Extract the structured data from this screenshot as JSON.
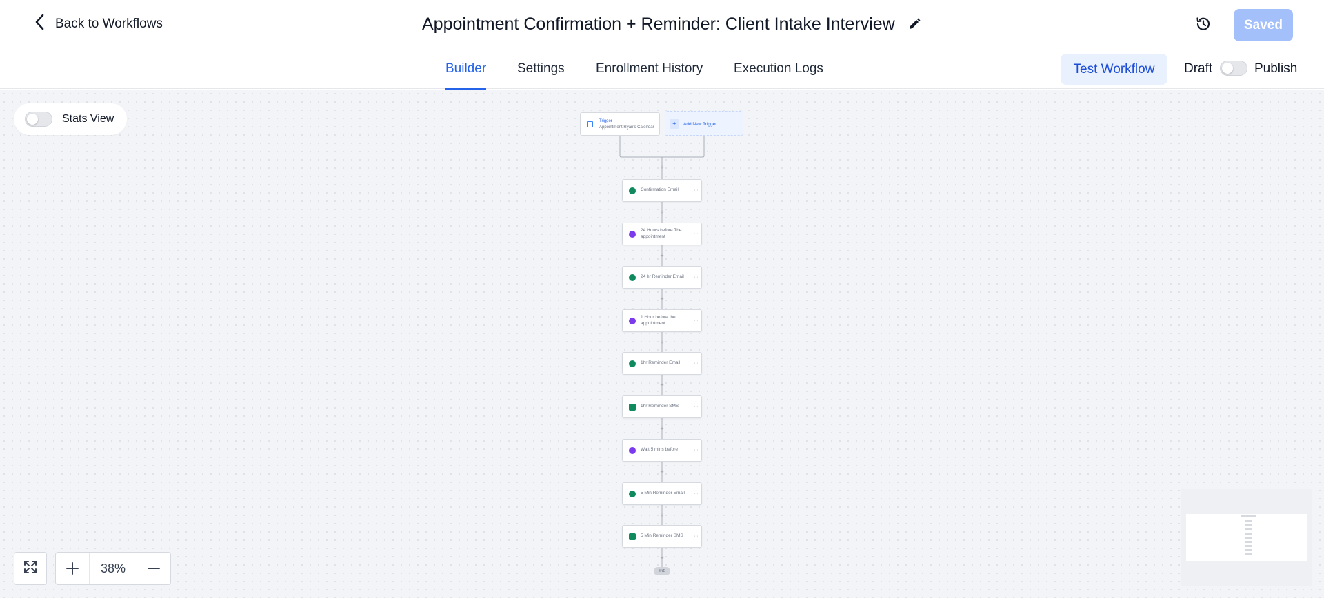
{
  "header": {
    "back_label": "Back to Workflows",
    "title": "Appointment Confirmation + Reminder: Client Intake Interview",
    "saved_label": "Saved"
  },
  "tabs": [
    {
      "label": "Builder",
      "active": true
    },
    {
      "label": "Settings",
      "active": false
    },
    {
      "label": "Enrollment History",
      "active": false
    },
    {
      "label": "Execution Logs",
      "active": false
    }
  ],
  "actions": {
    "test_label": "Test Workflow",
    "draft_label": "Draft",
    "publish_label": "Publish",
    "publish_on": false
  },
  "canvas": {
    "stats_label": "Stats View",
    "stats_on": false,
    "zoom": "38%",
    "trigger": {
      "heading": "Trigger",
      "name": "Appointment Ryan's Calendar",
      "add_label": "Add New Trigger"
    },
    "steps": [
      {
        "label": "Confirmation Email",
        "icon": "email-icon"
      },
      {
        "label": "24 Hours before The appointment",
        "icon": "wait-clock-icon"
      },
      {
        "label": "24 hr Reminder Email",
        "icon": "email-icon"
      },
      {
        "label": "1 Hour before the appointment",
        "icon": "wait-clock-icon"
      },
      {
        "label": "1hr Reminder Email",
        "icon": "email-icon"
      },
      {
        "label": "1hr Reminder SMS",
        "icon": "sms-icon"
      },
      {
        "label": "Wait 5 mins before",
        "icon": "wait-clock-icon"
      },
      {
        "label": "5 Min Reminder Email",
        "icon": "email-icon"
      },
      {
        "label": "5 Min Reminder SMS",
        "icon": "sms-icon"
      }
    ],
    "end_label": "END"
  },
  "colors": {
    "accent": "#2563eb",
    "saved_button": "#a3c0fb",
    "email_icon": "#0f8a5f",
    "wait_icon": "#7c3aed"
  }
}
